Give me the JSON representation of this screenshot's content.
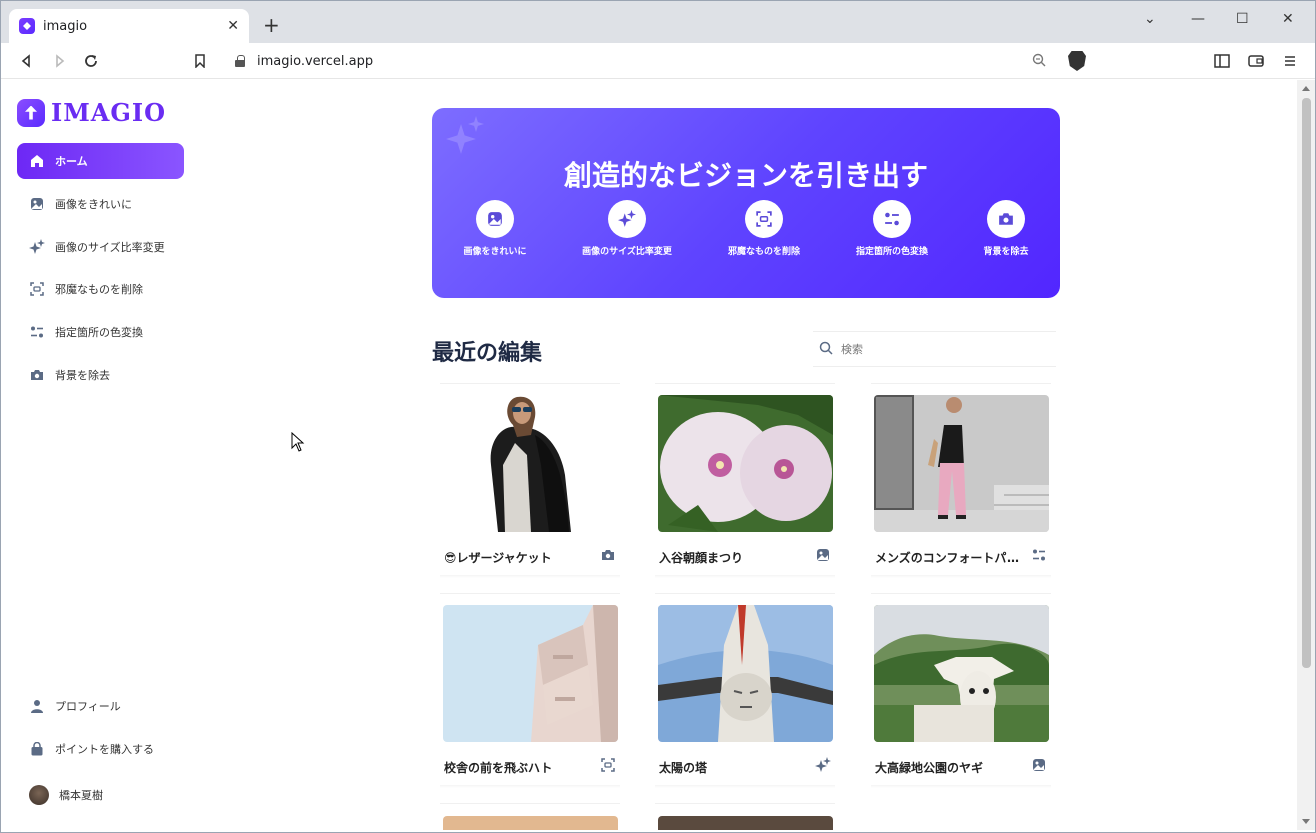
{
  "browser": {
    "tab_title": "imagio",
    "tab_close": "✕",
    "new_tab": "+",
    "url": "imagio.vercel.app",
    "minimize": "⌄",
    "window_min": "—",
    "window_max": "☐",
    "window_close": "✕"
  },
  "sidebar": {
    "logo": "IMAGIO",
    "nav": [
      {
        "label": "ホーム",
        "icon": "home-icon",
        "active": true
      },
      {
        "label": "画像をきれいに",
        "icon": "image-icon"
      },
      {
        "label": "画像のサイズ比率変更",
        "icon": "sparkle-icon"
      },
      {
        "label": "邪魔なものを削除",
        "icon": "erase-icon"
      },
      {
        "label": "指定箇所の色変換",
        "icon": "color-swap-icon"
      },
      {
        "label": "背景を除去",
        "icon": "camera-icon"
      }
    ],
    "bottom": [
      {
        "label": "プロフィール",
        "icon": "user-icon"
      },
      {
        "label": "ポイントを購入する",
        "icon": "bag-icon"
      },
      {
        "label": "橋本夏樹",
        "icon": "avatar"
      }
    ]
  },
  "hero": {
    "title": "創造的なビジョンを引き出す",
    "actions": [
      {
        "label": "画像をきれいに",
        "icon": "image-icon"
      },
      {
        "label": "画像のサイズ比率変更",
        "icon": "sparkle-icon"
      },
      {
        "label": "邪魔なものを削除",
        "icon": "erase-icon"
      },
      {
        "label": "指定箇所の色変換",
        "icon": "color-swap-icon"
      },
      {
        "label": "背景を除去",
        "icon": "camera-icon"
      }
    ]
  },
  "recent": {
    "title": "最近の編集",
    "search_placeholder": "検索",
    "cards": [
      {
        "title": "😎レザージャケット",
        "icon": "camera-icon"
      },
      {
        "title": "入谷朝顔まつり",
        "icon": "image-icon"
      },
      {
        "title": "メンズのコンフォートパンツ",
        "icon": "color-swap-icon"
      },
      {
        "title": "校舎の前を飛ぶハト",
        "icon": "erase-icon"
      },
      {
        "title": "太陽の塔",
        "icon": "sparkle-icon"
      },
      {
        "title": "大高緑地公園のヤギ",
        "icon": "image-icon"
      }
    ]
  },
  "colors": {
    "accent": "#6d28f5",
    "hero_start": "#7d6dff",
    "hero_end": "#5226ff",
    "icon_gray": "#5b6b85"
  }
}
